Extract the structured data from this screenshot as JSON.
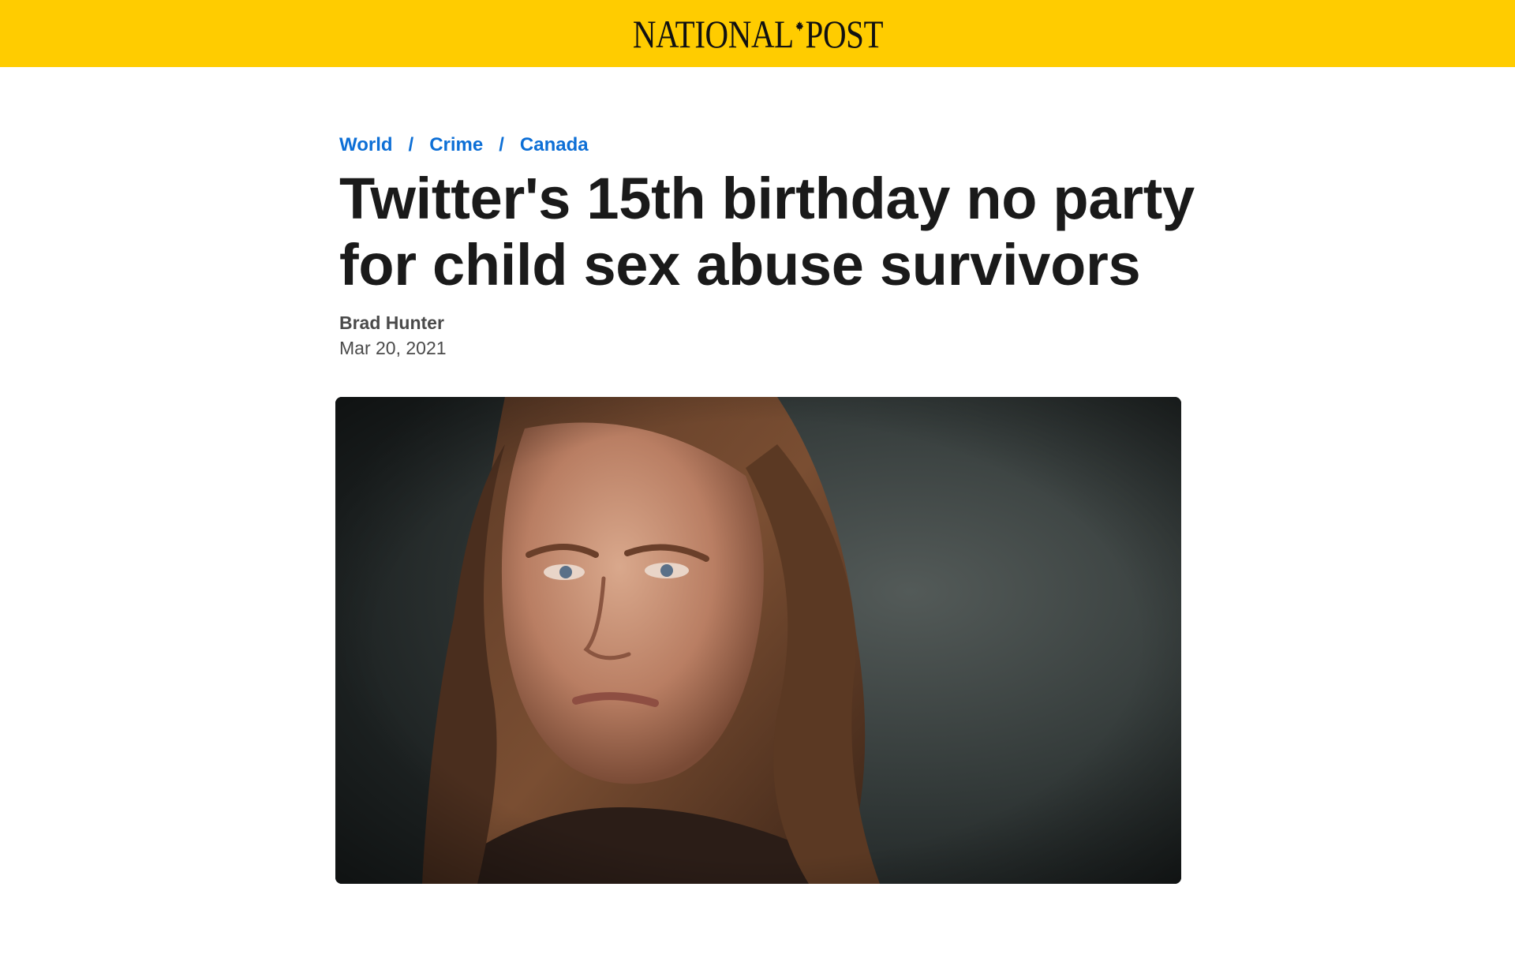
{
  "header": {
    "logo_left": "NATIONAL",
    "logo_right": "POST",
    "background_color": "#ffcc00"
  },
  "breadcrumb": {
    "items": [
      "World",
      "Crime",
      "Canada"
    ],
    "separator": "/",
    "link_color": "#0d6fd6"
  },
  "article": {
    "headline": "Twitter's 15th birthday no party for child sex abuse survivors",
    "author": "Brad Hunter",
    "date": "Mar 20, 2021"
  },
  "hero_image": {
    "icon": "photo-of-woman-portrait"
  }
}
